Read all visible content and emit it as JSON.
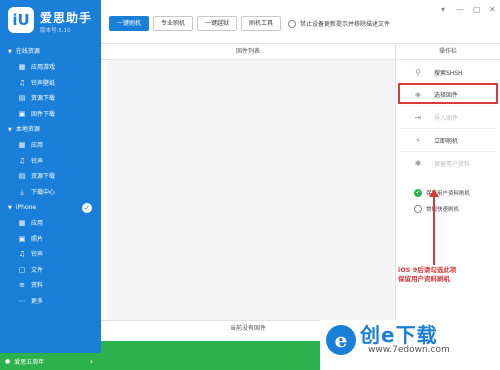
{
  "app": {
    "logo_text": "iU",
    "name": "爱思助手",
    "version": "版本号:5.10"
  },
  "sidebar": {
    "sections": [
      {
        "title": "在线资源",
        "items": [
          {
            "label": "应用游戏",
            "icon": "apps-icon"
          },
          {
            "label": "铃声壁纸",
            "icon": "ringtone-icon"
          },
          {
            "label": "资源下载",
            "icon": "download-icon"
          },
          {
            "label": "固件下载",
            "icon": "firmware-icon"
          }
        ]
      },
      {
        "title": "本地资源",
        "items": [
          {
            "label": "应用",
            "icon": "apps-icon"
          },
          {
            "label": "铃声",
            "icon": "ringtone-icon"
          },
          {
            "label": "资源下载",
            "icon": "download-icon"
          },
          {
            "label": "下载中心",
            "icon": "download-center-icon"
          }
        ]
      },
      {
        "title": "iPhone",
        "items": [
          {
            "label": "应用",
            "icon": "apps-icon"
          },
          {
            "label": "照片",
            "icon": "photo-icon"
          },
          {
            "label": "铃声",
            "icon": "ringtone-icon"
          },
          {
            "label": "文件",
            "icon": "file-icon"
          },
          {
            "label": "资料",
            "icon": "contacts-icon"
          },
          {
            "label": "更多",
            "icon": "more-icon"
          }
        ]
      }
    ],
    "promo": "爱思五周年"
  },
  "topbar": {
    "tabs": [
      {
        "label": "一键刷机",
        "active": true
      },
      {
        "label": "专业刷机",
        "active": false
      },
      {
        "label": "一键越狱",
        "active": false
      },
      {
        "label": "刷机工具",
        "active": false
      }
    ],
    "checkbox_label": "禁止设备更新提示并移除描述文件"
  },
  "main": {
    "header": "固件列表",
    "footer": "当前没有固件"
  },
  "panel": {
    "header": "操作栏",
    "ops": [
      {
        "label": "搜索SHSH",
        "icon": "search-icon",
        "disabled": false
      },
      {
        "label": "选择固件",
        "icon": "cube-icon",
        "disabled": false
      },
      {
        "label": "导入固件",
        "icon": "import-icon",
        "disabled": true
      },
      {
        "label": "立即刷机",
        "icon": "flash-icon",
        "disabled": false
      },
      {
        "label": "保留用户资料",
        "icon": "settings-icon",
        "disabled": true
      }
    ],
    "options": [
      {
        "label": "保留用户资料刷机",
        "checked": true
      },
      {
        "label": "常规快速刷机",
        "checked": false
      }
    ]
  },
  "annotation": {
    "line1": "iOS 9后请勾选此项",
    "line2": "保留用户资料刷机"
  },
  "watermark": {
    "logo": "e",
    "title": "创e下载",
    "url": "www.7edown.com"
  },
  "colors": {
    "primary": "#1a7fd9",
    "green": "#2bb24c",
    "annotation": "#d93a3a"
  }
}
